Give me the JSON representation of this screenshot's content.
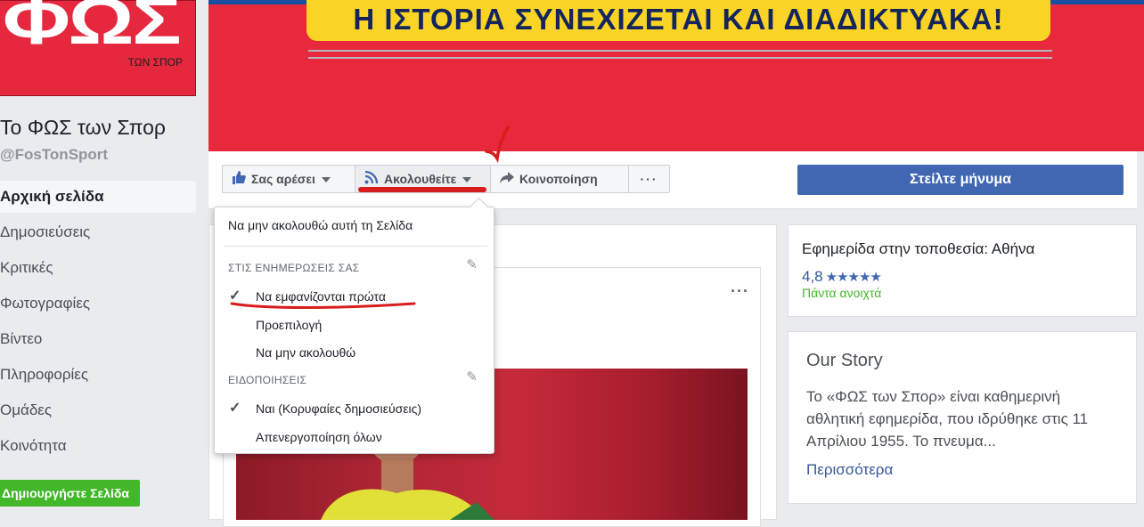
{
  "sidebar": {
    "logo_big": "ΦΩΣ",
    "logo_small": "ΤΩΝ ΣΠΟΡ",
    "page_name": "Το ΦΩΣ των Σπορ",
    "page_handle": "@FosTonSport",
    "nav": [
      {
        "label": "Αρχική σελίδα",
        "active": true
      },
      {
        "label": "Δημοσιεύσεις"
      },
      {
        "label": "Κριτικές"
      },
      {
        "label": "Φωτογραφίες"
      },
      {
        "label": "Βίντεο"
      },
      {
        "label": "Πληροφορίες"
      },
      {
        "label": "Ομάδες"
      },
      {
        "label": "Κοινότητα"
      }
    ],
    "create_page": "Δημιουργήστε Σελίδα"
  },
  "cover": {
    "banner_text": "Η ΙΣΤΟΡΙΑ ΣΥΝΕΧΙΖΕΤΑΙ ΚΑΙ ΔΙΑΔΙΚΤΥΑΚΑ!",
    "background": "#e8283d",
    "banner_color": "#f9d424"
  },
  "actions": {
    "like": "Σας αρέσει",
    "follow": "Ακολουθείτε",
    "share": "Κοινοποίηση",
    "more": "···",
    "message": "Στείλτε μήνυμα"
  },
  "dropdown": {
    "unfollow": "Να μην ακολουθώ αυτή τη Σελίδα",
    "updates_header": "ΣΤΙΣ ΕΝΗΜΕΡΩΣΕΙΣ ΣΑΣ",
    "updates": [
      "Να εμφανίζονται πρώτα",
      "Προεπιλογή",
      "Να μην ακολουθώ"
    ],
    "updates_selected": 0,
    "notifications_header": "ΕΙΔΟΠΟΙΗΣΕΙΣ",
    "notifications": [
      "Ναι (Κορυφαίες δημοσιεύσεις)",
      "Απενεργοποίηση όλων"
    ],
    "notifications_selected": 0
  },
  "info_card": {
    "type": "Εφημερίδα στην τοποθεσία: Αθήνα",
    "rating": "4,8",
    "stars": "★★★★★",
    "status": "Πάντα ανοιχτά"
  },
  "story_card": {
    "title": "Our Story",
    "text": "Το «ΦΩΣ των Σπορ» είναι καθημερινή αθλητική εφημερίδα, που ιδρύθηκε στις 11 Απρίλιου 1955. Το πνευμα...",
    "more": "Περισσότερα"
  },
  "post": {
    "menu": "···"
  },
  "colors": {
    "primary": "#4267b2",
    "annotation_red": "#d91c1c",
    "green": "#42b72a"
  }
}
